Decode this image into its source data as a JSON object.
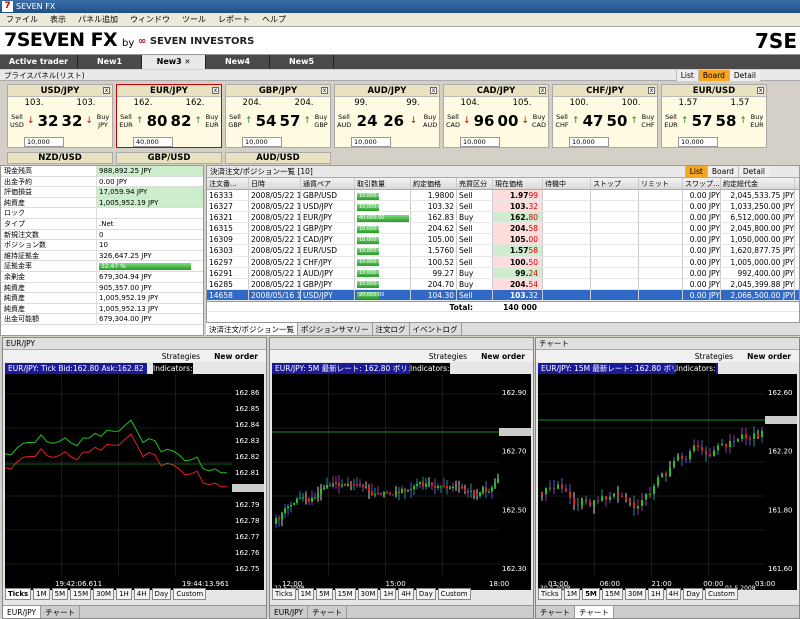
{
  "window": {
    "title": "SEVEN FX"
  },
  "menu": [
    "ファイル",
    "表示",
    "パネル追加",
    "ウィンドウ",
    "ツール",
    "レポート",
    "ヘルプ"
  ],
  "brand": {
    "logo": "7SEVEN FX",
    "by": "by",
    "investors": "SEVEN INVESTORS",
    "right": "7SE"
  },
  "tabs": [
    "Active trader",
    "New1",
    "New3",
    "New4",
    "New5"
  ],
  "price_panel": {
    "title": "プライスパネル(リスト)",
    "views": [
      "List",
      "Board",
      "Detail"
    ]
  },
  "cards": [
    {
      "pair": "USD/JPY",
      "bid_big": "103.",
      "ask_big": "103.",
      "sell": "32",
      "buy": "32",
      "sell_ccy": "USD",
      "buy_ccy": "JPY",
      "sell_dir": "down",
      "buy_dir": "down",
      "amount": "10,000"
    },
    {
      "pair": "EUR/JPY",
      "bid_big": "162.",
      "ask_big": "162.",
      "sell": "80",
      "buy": "82",
      "sell_ccy": "EUR",
      "buy_ccy": "EUR",
      "sell_dir": "up",
      "buy_dir": "up",
      "amount": "40,000"
    },
    {
      "pair": "GBP/JPY",
      "bid_big": "204.",
      "ask_big": "204.",
      "sell": "54",
      "buy": "57",
      "sell_ccy": "GBP",
      "buy_ccy": "GBP",
      "sell_dir": "up",
      "buy_dir": "up",
      "amount": "10,000"
    },
    {
      "pair": "AUD/JPY",
      "bid_big": "99.",
      "ask_big": "99.",
      "sell": "24",
      "buy": "26",
      "sell_ccy": "AUD",
      "buy_ccy": "AUD",
      "sell_dir": "none",
      "buy_dir": "down",
      "amount": "10,000"
    },
    {
      "pair": "CAD/JPY",
      "bid_big": "104.",
      "ask_big": "105.",
      "sell": "96",
      "buy": "00",
      "sell_ccy": "CAD",
      "buy_ccy": "CAD",
      "sell_dir": "down",
      "buy_dir": "down",
      "amount": "10,000"
    },
    {
      "pair": "CHF/JPY",
      "bid_big": "100.",
      "ask_big": "100.",
      "sell": "47",
      "buy": "50",
      "sell_ccy": "CHF",
      "buy_ccy": "CHF",
      "sell_dir": "up",
      "buy_dir": "up",
      "amount": "10,000"
    },
    {
      "pair": "EUR/USD",
      "bid_big": "1.57",
      "ask_big": "1.57",
      "sell": "57",
      "buy": "58",
      "sell_ccy": "EUR",
      "buy_ccy": "EUR",
      "sell_dir": "up",
      "buy_dir": "up",
      "amount": "10,000"
    }
  ],
  "cards_row2": [
    "NZD/USD",
    "GBP/USD",
    "AUD/USD"
  ],
  "account": [
    {
      "k": "現金残高",
      "v": "988,892.25 JPY",
      "green": true
    },
    {
      "k": "出金予約",
      "v": "0.00 JPY",
      "green": false
    },
    {
      "k": "評価損益",
      "v": "17,059.94 JPY",
      "green": true
    },
    {
      "k": "純資産",
      "v": "1,005,952.19 JPY",
      "green": true
    },
    {
      "k": "ロック",
      "v": "",
      "green": false
    },
    {
      "k": "タイプ",
      "v": ".Net",
      "green": false
    },
    {
      "k": "新規注文数",
      "v": "0",
      "green": false
    },
    {
      "k": "ポジション数",
      "v": "10",
      "green": false
    },
    {
      "k": "維持証拠金",
      "v": "326,647.25 JPY",
      "green": false
    },
    {
      "k": "証拠金率",
      "v": "32.47 %",
      "green": false,
      "bar": true
    },
    {
      "k": "余剰金",
      "v": "679,304.94 JPY",
      "green": false
    },
    {
      "k": "純資産",
      "v": "905,357.00 JPY",
      "green": false
    },
    {
      "k": "純資産",
      "v": "1,005,952.19 JPY",
      "green": false
    },
    {
      "k": "純資産",
      "v": "1,005,952.13 JPY",
      "green": false
    },
    {
      "k": "出金可能額",
      "v": "679,304.00 JPY",
      "green": false
    }
  ],
  "orders": {
    "title": "決済注文/ポジション一覧",
    "count": "[10]",
    "views": [
      "List",
      "Board",
      "Detail"
    ],
    "headers": [
      "注文番...",
      "日時",
      "通貨ペア",
      "取引数量",
      "約定価格",
      "売買区分",
      "現在価格",
      "待機中",
      "ストップ",
      "リミット",
      "スワップ...",
      "約定総代金"
    ],
    "rows": [
      {
        "id": "16333",
        "date": "2008/05/22 1...",
        "pair": "GBP/USD",
        "qty": "10,000.00",
        "price": "1.9800",
        "side": "Sell",
        "cur_a": "1.97",
        "cur_b": "99",
        "swap": "0.00  JPY",
        "total": "2,045,533.75  JPY",
        "hl": "r"
      },
      {
        "id": "16327",
        "date": "2008/05/22 1...",
        "pair": "USD/JPY",
        "qty": "10,000.00",
        "price": "103.32",
        "side": "Sell",
        "cur_a": "103.",
        "cur_b": "32",
        "swap": "0.00  JPY",
        "total": "1,033,250.00  JPY",
        "hl": "r"
      },
      {
        "id": "16321",
        "date": "2008/05/22 1...",
        "pair": "EUR/JPY",
        "qty": "40,000.00",
        "price": "162.83",
        "side": "Buy",
        "cur_a": "162.",
        "cur_b": "80",
        "swap": "0.00  JPY",
        "total": "6,512,000.00  JPY",
        "hl": "g",
        "qtyfull": true
      },
      {
        "id": "16315",
        "date": "2008/05/22 1...",
        "pair": "GBP/JPY",
        "qty": "10,000.00",
        "price": "204.62",
        "side": "Sell",
        "cur_a": "204.",
        "cur_b": "58",
        "swap": "0.00  JPY",
        "total": "2,045,800.00  JPY",
        "hl": "r"
      },
      {
        "id": "16309",
        "date": "2008/05/22 1...",
        "pair": "CAD/JPY",
        "qty": "10,000.00",
        "price": "105.00",
        "side": "Sell",
        "cur_a": "105.",
        "cur_b": "00",
        "swap": "0.00  JPY",
        "total": "1,050,000.00  JPY",
        "hl": "r"
      },
      {
        "id": "16303",
        "date": "2008/05/22 1...",
        "pair": "EUR/USD",
        "qty": "10,000.00",
        "price": "1.5760",
        "side": "Sell",
        "cur_a": "1.57",
        "cur_b": "58",
        "swap": "0.00  JPY",
        "total": "1,620,877.75  JPY",
        "hl": "g"
      },
      {
        "id": "16297",
        "date": "2008/05/22 1...",
        "pair": "CHF/JPY",
        "qty": "10,000.00",
        "price": "100.52",
        "side": "Sell",
        "cur_a": "100.",
        "cur_b": "50",
        "swap": "0.00  JPY",
        "total": "1,005,000.00  JPY",
        "hl": "r"
      },
      {
        "id": "16291",
        "date": "2008/05/22 1...",
        "pair": "AUD/JPY",
        "qty": "10,000.00",
        "price": "99.27",
        "side": "Buy",
        "cur_a": "99.",
        "cur_b": "24",
        "swap": "0.00  JPY",
        "total": "992,400.00  JPY",
        "hl": "g"
      },
      {
        "id": "16285",
        "date": "2008/05/22 1...",
        "pair": "GBP/JPY",
        "qty": "10,000.00",
        "price": "204.70",
        "side": "Buy",
        "cur_a": "204.",
        "cur_b": "54",
        "swap": "0.00  JPY",
        "total": "2,045,399.88  JPY",
        "hl": "r"
      },
      {
        "id": "14658",
        "date": "2008/05/16 1...",
        "pair": "USD/JPY",
        "qty": "20,000.00",
        "price": "104.30",
        "side": "Sell",
        "cur_a": "103.",
        "cur_b": "32",
        "swap": "0.00  JPY",
        "total": "2,066,500.00  JPY",
        "hl": "sel"
      }
    ],
    "total_label": "Total:",
    "total_value": "140 000",
    "tabs": [
      "決済注文/ポジション一覧",
      "ポジションサマリー",
      "注文ログ",
      "イベントログ"
    ]
  },
  "charts": [
    {
      "title": "EUR/JPY",
      "info": "EUR/JPY: Tick Bid:162.80 Ask:162.82",
      "strategies": "Strategies",
      "new_order": "New order",
      "indicators": "Indicators:",
      "yticks": [
        "162.86",
        "162.85",
        "162.84",
        "162.83",
        "162.82",
        "162.81",
        "162.80",
        "162.79",
        "162.78",
        "162.77",
        "162.76",
        "162.75"
      ],
      "xticks": [
        "19:42:06.611",
        "19:44:13.961"
      ],
      "tfs": [
        "Ticks",
        "1M",
        "5M",
        "15M",
        "30M",
        "1H",
        "4H",
        "Day",
        "Custom"
      ],
      "tf_on": "Ticks",
      "bottom_tabs": [
        "EUR/JPY",
        "チャート"
      ],
      "bottom_on": 0
    },
    {
      "title": "",
      "info": "EUR/JPY: 5M 最新レート: 162.80 ボリューム: 45",
      "strategies": "Strategies",
      "new_order": "New order",
      "indicators": "Indicators:",
      "yticks": [
        "162.90",
        "162.70",
        "162.50",
        "162.30"
      ],
      "xticks": [
        "12:00",
        "15:00",
        "18:00"
      ],
      "xsub": "22.5.2008",
      "tfs": [
        "Ticks",
        "1M",
        "5M",
        "15M",
        "30M",
        "1H",
        "4H",
        "Day",
        "Custom"
      ],
      "tf_on": "",
      "bottom_tabs": [
        "EUR/JPY",
        "チャート"
      ],
      "bottom_on": -1
    },
    {
      "title": "チャート",
      "info": "EUR/JPY: 15M 最新レート: 162.80 ボリューム: 45",
      "strategies": "Strategies",
      "new_order": "New order",
      "indicators": "Indicators:",
      "yticks": [
        "162.60",
        "162.20",
        "161.80",
        "161.60"
      ],
      "xticks": [
        "03:00",
        "06:00",
        "21:00",
        "00:00",
        "03:00"
      ],
      "xsub": "30.4.2008",
      "xsub2": "01.5.2008",
      "tfs": [
        "Ticks",
        "1M",
        "5M",
        "15M",
        "30M",
        "1H",
        "4H",
        "Day",
        "Custom"
      ],
      "tf_on": "5M",
      "bottom_tabs": [
        "チャート",
        "チャート"
      ],
      "bottom_on": 1
    }
  ]
}
